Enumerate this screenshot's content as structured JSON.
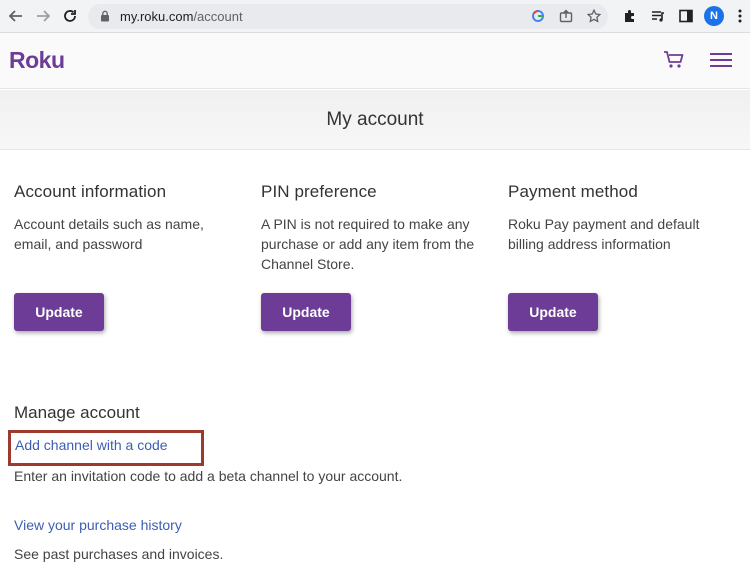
{
  "browser": {
    "url_host": "my.roku.com",
    "url_path": "/account",
    "profile_initial": "N"
  },
  "site": {
    "logo": "Roku"
  },
  "page": {
    "title": "My account"
  },
  "sections": [
    {
      "title": "Account information",
      "description": "Account details such as name, email, and password",
      "button": "Update"
    },
    {
      "title": "PIN preference",
      "description": "A PIN is not required to make any purchase or add any item from the Channel Store.",
      "button": "Update"
    },
    {
      "title": "Payment method",
      "description": "Roku Pay payment and default billing address information",
      "button": "Update"
    }
  ],
  "manage": {
    "title": "Manage account",
    "links": [
      {
        "label": "Add channel with a code",
        "description": "Enter an invitation code to add a beta channel to your account."
      },
      {
        "label": "View your purchase history",
        "description": "See past purchases and invoices."
      }
    ]
  },
  "colors": {
    "brand": "#6c3c97",
    "link": "#3d5eb2",
    "highlight": "#9b3a2d"
  }
}
